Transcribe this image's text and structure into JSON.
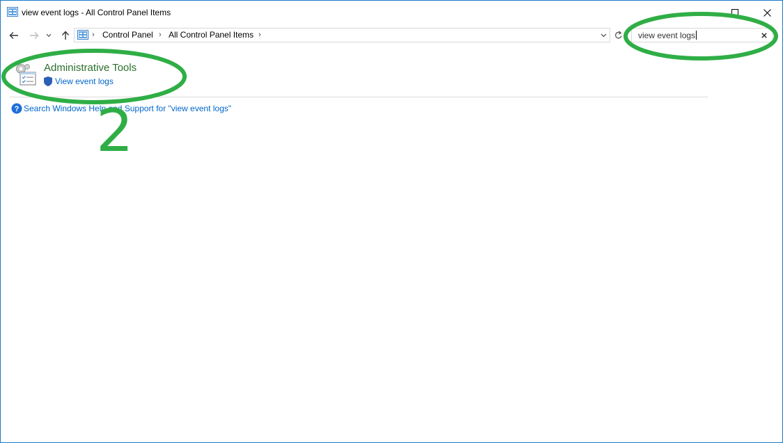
{
  "window": {
    "title": "view event logs - All Control Panel Items"
  },
  "navigation": {
    "breadcrumbs": [
      "Control Panel",
      "All Control Panel Items"
    ]
  },
  "search": {
    "value": "view event logs"
  },
  "results": {
    "group_title": "Administrative Tools",
    "link": "View event logs"
  },
  "help": {
    "link": "Search Windows Help and Support for \"view event logs\""
  },
  "annotation": {
    "step_number": "2",
    "color": "#2fae46"
  },
  "colors": {
    "accent_border": "#1979ca",
    "group_title": "#2a6e2a",
    "link": "#0066cc"
  },
  "icons": {
    "window": "control-panel-icon",
    "back": "back-arrow-icon",
    "forward": "forward-arrow-icon",
    "recent": "chevron-down-icon",
    "up": "up-arrow-icon",
    "refresh": "refresh-icon",
    "clear": "close-icon",
    "group": "administrative-tools-icon",
    "shield": "uac-shield-icon",
    "help": "help-icon"
  }
}
